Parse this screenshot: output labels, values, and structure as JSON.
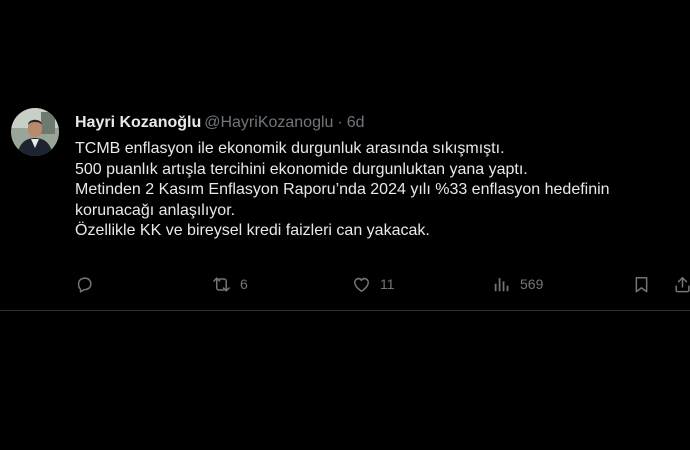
{
  "tweet": {
    "author": {
      "display_name": "Hayri Kozanoğlu",
      "handle": "@HayriKozanoglu",
      "separator": "·",
      "time": "6d"
    },
    "lines": [
      "TCMB enflasyon ile ekonomik durgunluk arasında sıkışmıştı.",
      "500 puanlık artışla tercihini ekonomide durgunluktan yana yaptı.",
      "Metinden 2 Kasım Enflasyon Raporu’nda 2024 yılı %33 enflasyon hedefinin",
      "korunacağı anlaşılıyor.",
      "Özellikle KK ve bireysel kredi faizleri can yakacak."
    ],
    "actions": {
      "reply": {
        "icon": "reply-icon",
        "count": ""
      },
      "retweet": {
        "icon": "retweet-icon",
        "count": "6"
      },
      "like": {
        "icon": "heart-icon",
        "count": "11"
      },
      "views": {
        "icon": "views-chart-icon",
        "count": "569"
      },
      "bookmark": {
        "icon": "bookmark-icon"
      },
      "share": {
        "icon": "share-icon"
      }
    }
  },
  "colors": {
    "background": "#000000",
    "primary_text": "#e7e9ea",
    "secondary_text": "#71767b",
    "divider": "#2f3336"
  }
}
